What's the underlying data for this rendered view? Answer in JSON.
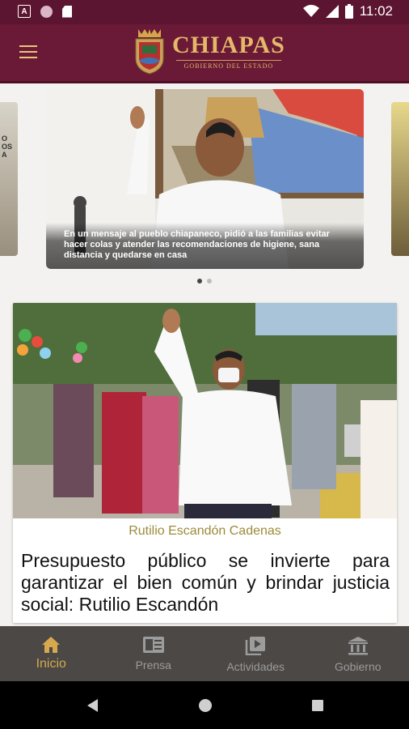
{
  "status_bar": {
    "time": "11:02",
    "app_icon_letter": "A"
  },
  "app_bar": {
    "brand_title": "CHIAPAS",
    "brand_subtitle": "GOBIERNO DEL ESTADO"
  },
  "carousel": {
    "left_peek_text": "O\nOS\nA",
    "slides": [
      {
        "caption": "En un mensaje al pueblo chiapaneco, pidió a las familias evitar hacer colas y atender las recomendaciones de higiene, sana distancia y quedarse en casa"
      }
    ],
    "page_count": 2,
    "active_index": 0
  },
  "news": {
    "author": "Rutilio Escandón Cadenas",
    "title": "Presupuesto público se invierte para garantizar el bien común y brindar justicia social: Rutilio Escandón"
  },
  "bottom_nav": {
    "items": [
      {
        "label": "Inicio",
        "icon": "home-icon",
        "active": true
      },
      {
        "label": "Prensa",
        "icon": "newspaper-icon",
        "active": false
      },
      {
        "label": "Actividades",
        "icon": "video-library-icon",
        "active": false
      },
      {
        "label": "Gobierno",
        "icon": "government-building-icon",
        "active": false
      }
    ]
  },
  "colors": {
    "primary": "#6a1a36",
    "accent_gold": "#d6a94f",
    "nav_bg": "#4b4846"
  }
}
